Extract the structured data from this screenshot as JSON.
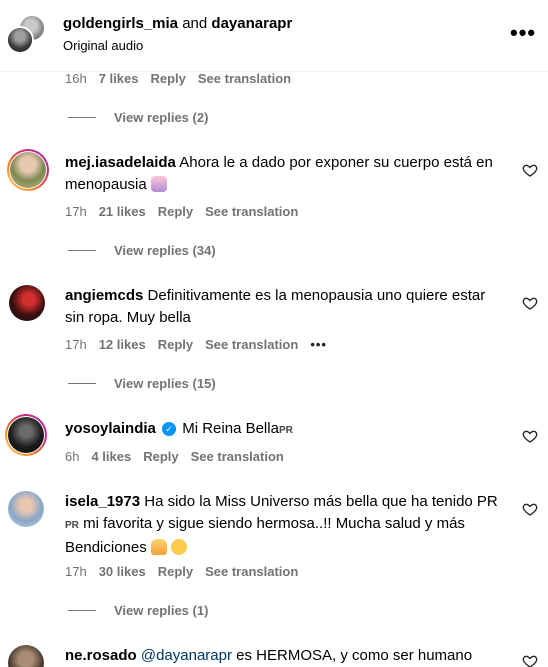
{
  "header": {
    "user1": "goldengirls_mia",
    "joiner": "and",
    "user2": "dayanarapr",
    "subtitle": "Original audio"
  },
  "top_meta": {
    "time": "16h",
    "likes": "7 likes",
    "reply": "Reply",
    "translate": "See translation"
  },
  "top_replies": "View replies (2)",
  "comments": [
    {
      "user": "mej.iasadelaida",
      "text": "Ahora le a dado por exponer su cuerpo está en menopausia",
      "time": "17h",
      "likes": "21 likes",
      "reply": "Reply",
      "translate": "See translation",
      "replies": "View replies (34)"
    },
    {
      "user": "angiemcds",
      "text": "Definitivamente es la menopausia uno quiere estar sin ropa. Muy bella",
      "time": "17h",
      "likes": "12 likes",
      "reply": "Reply",
      "translate": "See translation",
      "more": "•••",
      "replies": "View replies (15)"
    },
    {
      "user": "yosoylaindia",
      "text": "Mi Reina Bella",
      "flag": "PR",
      "time": "6h",
      "likes": "4 likes",
      "reply": "Reply",
      "translate": "See translation"
    },
    {
      "user": "isela_1973",
      "text1": "Ha sido la Miss Universo más bella que ha tenido PR",
      "flag": "PR",
      "text2": "mi favorita y sigue siendo hermosa..!! Mucha salud y más Bendiciones",
      "time": "17h",
      "likes": "30 likes",
      "reply": "Reply",
      "translate": "See translation",
      "replies": "View replies (1)"
    },
    {
      "user": "ne.rosado",
      "mention": "@dayanarapr",
      "text": "es HERMOSA, y como ser humano"
    }
  ],
  "colors": {
    "meta": "#737373",
    "link": "#00376b",
    "verified": "#0095f6"
  }
}
